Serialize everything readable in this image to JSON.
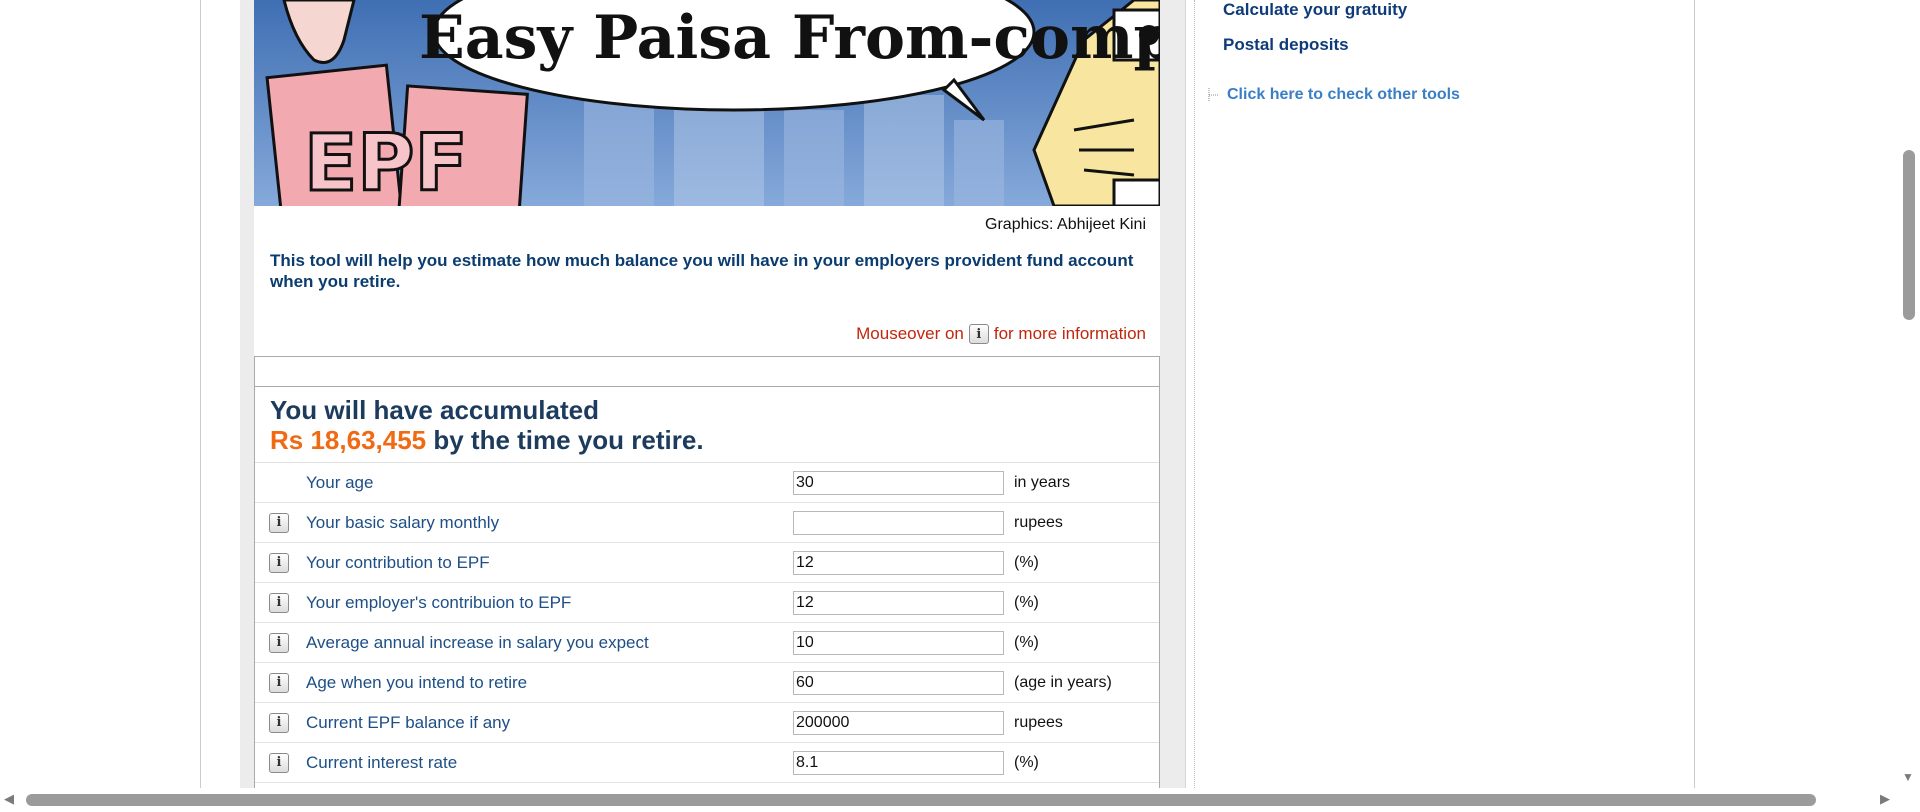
{
  "banner": {
    "headline": "Easy Paisa From-company!",
    "sign_text": "EPF"
  },
  "credit": "Graphics: Abhijeet Kini",
  "intro": "This tool will help you estimate how much balance you will have in your employers provident fund account when you retire.",
  "mouseover": {
    "before": "Mouseover on",
    "after": "for more information",
    "icon": "info-icon"
  },
  "result": {
    "line1": "You will have accumulated",
    "amount": "Rs 18,63,455",
    "suffix": " by the time you retire."
  },
  "fields": [
    {
      "label": "Your age",
      "value": "30",
      "unit": "in years",
      "has_info": false
    },
    {
      "label": "Your basic salary monthly",
      "value": "",
      "unit": "rupees",
      "has_info": true
    },
    {
      "label": "Your contribution to EPF",
      "value": "12",
      "unit": "(%)",
      "has_info": true
    },
    {
      "label": "Your employer's contribuion to EPF",
      "value": "12",
      "unit": "(%)",
      "has_info": true
    },
    {
      "label": "Average annual increase in salary you expect",
      "value": "10",
      "unit": "(%)",
      "has_info": true
    },
    {
      "label": "Age when you intend to retire",
      "value": "60",
      "unit": "(age in years)",
      "has_info": true
    },
    {
      "label": "Current EPF balance if any",
      "value": "200000",
      "unit": "rupees",
      "has_info": true
    },
    {
      "label": "Current interest rate",
      "value": "8.1",
      "unit": "(%)",
      "has_info": true
    }
  ],
  "sidebar": {
    "links": [
      "Calculate your gratuity",
      "Postal deposits"
    ],
    "tools_link": "Click here to check other tools"
  },
  "colors": {
    "accent_orange": "#f06a14",
    "link_blue": "#0f3c79",
    "note_red": "#c0270c"
  }
}
